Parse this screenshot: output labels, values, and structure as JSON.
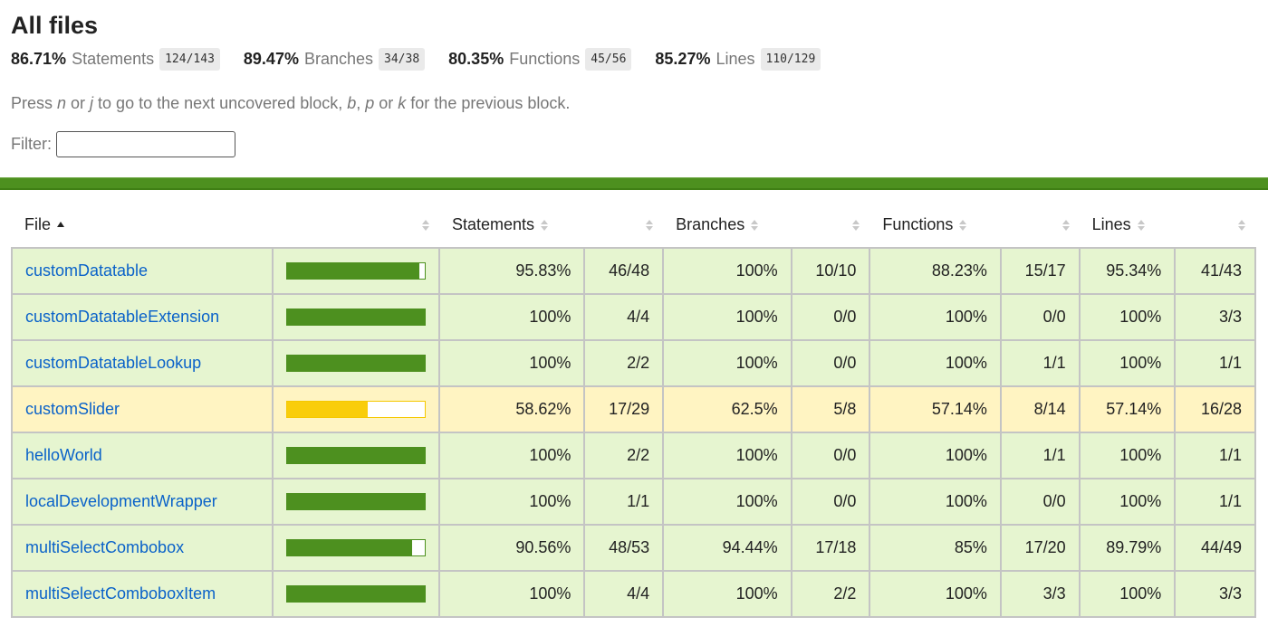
{
  "title": "All files",
  "summary": [
    {
      "pct": "86.71%",
      "label": "Statements",
      "fraction": "124/143"
    },
    {
      "pct": "89.47%",
      "label": "Branches",
      "fraction": "34/38"
    },
    {
      "pct": "80.35%",
      "label": "Functions",
      "fraction": "45/56"
    },
    {
      "pct": "85.27%",
      "label": "Lines",
      "fraction": "110/129"
    }
  ],
  "hint": {
    "p1": "Press ",
    "k1": "n",
    "p2": " or ",
    "k2": "j",
    "p3": " to go to the next uncovered block, ",
    "k3": "b",
    "p4": ", ",
    "k4": "p",
    "p5": " or ",
    "k5": "k",
    "p6": " for the previous block."
  },
  "filter": {
    "label": "Filter:",
    "value": "",
    "placeholder": ""
  },
  "colors": {
    "high_bg": "#e6f5d0",
    "medium_bg": "#fff4c2",
    "high_bar": "#4d901f",
    "medium_bar": "#f9cd0b",
    "link": "#0a62c9",
    "status_bar": "#4d901f"
  },
  "table": {
    "headers": {
      "file": "File",
      "statements": "Statements",
      "branches": "Branches",
      "functions": "Functions",
      "lines": "Lines"
    },
    "sort": {
      "column": "File",
      "direction": "ascending"
    },
    "rows": [
      {
        "file": "customDatatable",
        "level": "high",
        "coverage": 95.83,
        "stmt_pct": "95.83%",
        "stmt": "46/48",
        "br_pct": "100%",
        "br": "10/10",
        "fn_pct": "88.23%",
        "fn": "15/17",
        "ln_pct": "95.34%",
        "ln": "41/43"
      },
      {
        "file": "customDatatableExtension",
        "level": "high",
        "coverage": 100,
        "stmt_pct": "100%",
        "stmt": "4/4",
        "br_pct": "100%",
        "br": "0/0",
        "fn_pct": "100%",
        "fn": "0/0",
        "ln_pct": "100%",
        "ln": "3/3"
      },
      {
        "file": "customDatatableLookup",
        "level": "high",
        "coverage": 100,
        "stmt_pct": "100%",
        "stmt": "2/2",
        "br_pct": "100%",
        "br": "0/0",
        "fn_pct": "100%",
        "fn": "1/1",
        "ln_pct": "100%",
        "ln": "1/1"
      },
      {
        "file": "customSlider",
        "level": "medium",
        "coverage": 58.62,
        "stmt_pct": "58.62%",
        "stmt": "17/29",
        "br_pct": "62.5%",
        "br": "5/8",
        "fn_pct": "57.14%",
        "fn": "8/14",
        "ln_pct": "57.14%",
        "ln": "16/28"
      },
      {
        "file": "helloWorld",
        "level": "high",
        "coverage": 100,
        "stmt_pct": "100%",
        "stmt": "2/2",
        "br_pct": "100%",
        "br": "0/0",
        "fn_pct": "100%",
        "fn": "1/1",
        "ln_pct": "100%",
        "ln": "1/1"
      },
      {
        "file": "localDevelopmentWrapper",
        "level": "high",
        "coverage": 100,
        "stmt_pct": "100%",
        "stmt": "1/1",
        "br_pct": "100%",
        "br": "0/0",
        "fn_pct": "100%",
        "fn": "0/0",
        "ln_pct": "100%",
        "ln": "1/1"
      },
      {
        "file": "multiSelectCombobox",
        "level": "high",
        "coverage": 90.56,
        "stmt_pct": "90.56%",
        "stmt": "48/53",
        "br_pct": "94.44%",
        "br": "17/18",
        "fn_pct": "85%",
        "fn": "17/20",
        "ln_pct": "89.79%",
        "ln": "44/49"
      },
      {
        "file": "multiSelectComboboxItem",
        "level": "high",
        "coverage": 100,
        "stmt_pct": "100%",
        "stmt": "4/4",
        "br_pct": "100%",
        "br": "2/2",
        "fn_pct": "100%",
        "fn": "3/3",
        "ln_pct": "100%",
        "ln": "3/3"
      }
    ]
  }
}
